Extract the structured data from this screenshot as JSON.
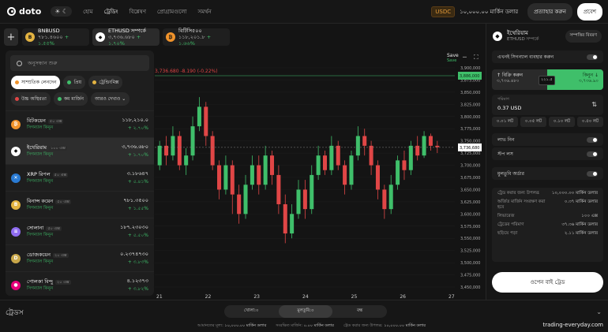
{
  "header": {
    "brand": "doto",
    "theme_toggle": "☀ ☾",
    "nav": [
      "হোম",
      "ট্রেডিং",
      "বিশ্লেষণ",
      "প্রোগ্রামগুলো",
      "সমর্থন"
    ],
    "active_nav": 1,
    "currency": "USDC",
    "balance": "১০,০০০.০০ মার্কিন ডলার",
    "deposit": "প্রত্যাহার করুন",
    "login": "প্রবেশ"
  },
  "tabs": [
    {
      "name": "BNBUSD",
      "price": "৭৮১.৪৬০০",
      "change": "+ ১.৫৫%",
      "color": "#e3b341",
      "glyph": "B"
    },
    {
      "name": "ETHUSD সম্পর্কে",
      "price": "৩,৭৩৬.৬৮০",
      "change": "+ ১.৭০%",
      "color": "#ffffff",
      "glyph": "◆",
      "active": true
    },
    {
      "name": "বিটিসি৫০০",
      "price": "১১৮,২০১.৮",
      "change": "+ ১.৬৬%",
      "color": "#f0932b",
      "glyph": "₿"
    }
  ],
  "panel": {
    "search_placeholder": "অনুসন্ধান শুরু",
    "chips": [
      {
        "label": "সাম্প্রতিক লেনদেন",
        "color": "#f0932b",
        "active": true
      },
      {
        "label": "প্রিয়",
        "color": "#3fbf6a"
      },
      {
        "label": "ট্রেন্ডিংমিক্স",
        "color": "#e3b341"
      },
      {
        "label": "উচ্চ অস্থিরতা",
        "color": "#e04646"
      },
      {
        "label": "কম মার্জিন",
        "color": "#3fbf6a"
      },
      {
        "label": "আরও দেখাও ⌄",
        "color": ""
      }
    ],
    "signal_label": "সিগন্যাল কিনুন",
    "items": [
      {
        "name": "বিটকয়েন",
        "tag": "৫০ এক্স",
        "price": "১১৮,২১০.০",
        "change": "+ ২.৭০%",
        "color": "#f0932b",
        "glyph": "₿"
      },
      {
        "name": "ইথেরিয়াম",
        "tag": "১০০ এক্স",
        "price": "৩,৭৩৬.৬৮০",
        "change": "+ ১.৭০%",
        "color": "#ffffff",
        "glyph": "◆",
        "sel": true
      },
      {
        "name": "XRP রিপল",
        "tag": "৫০ এক্স",
        "price": "৩.১৮৬৪৭",
        "change": "+ ৫.৪১%",
        "color": "#2a7bd4",
        "glyph": "✕"
      },
      {
        "name": "বিনান্স কয়েন",
        "tag": "৫০ এক্স",
        "price": "৭৮১.৩৫০০",
        "change": "+ ১.৫৫%",
        "color": "#e3b341",
        "glyph": "B"
      },
      {
        "name": "সোলানা",
        "tag": "৫০ এক্স",
        "price": "১৮৭.২৩০৩০",
        "change": "+ ৫.৫০%",
        "color": "#8f6cf0",
        "glyph": "≡"
      },
      {
        "name": "ডোজকয়েন",
        "tag": "২০ এক্স",
        "price": "০.২৩৭৪৭৩০",
        "change": "+ ৩.৮৩%",
        "color": "#c8a74a",
        "glyph": "D"
      },
      {
        "name": "পোলকা বিন্দু",
        "tag": "২০ এক্স",
        "price": "৪.১২৩৭৩",
        "change": "+ ৩.৮২%",
        "color": "#e6007a",
        "glyph": "●"
      }
    ]
  },
  "chart": {
    "save_label": "Save",
    "save_sub": "Save",
    "ohlc": "3,736.680 -8.190 (-0.22%)",
    "y_labels": [
      "3,900,000",
      "3,875,000",
      "3,850,000",
      "3,825,000",
      "3,800,000",
      "3,775,000",
      "3,750,000",
      "3,725,000",
      "3,700,000",
      "3,675,000",
      "3,650,000",
      "3,625,000",
      "3,600,000",
      "3,575,000",
      "3,550,000",
      "3,525,000",
      "3,500,000",
      "3,475,000",
      "3,450,000"
    ],
    "x_labels": [
      "21",
      "22",
      "23",
      "24",
      "25",
      "26",
      "27"
    ],
    "last_price": "3,736,680",
    "bid_price": "3,886,000"
  },
  "chart_data": {
    "type": "candlestick",
    "x": [
      "21",
      "22",
      "23",
      "24",
      "25",
      "26",
      "27"
    ],
    "ylim": [
      3450,
      3900
    ],
    "last": 3736.68,
    "candles": [
      [
        3700,
        3740,
        3690,
        3750
      ],
      [
        3740,
        3720,
        3700,
        3760
      ],
      [
        3720,
        3760,
        3710,
        3780
      ],
      [
        3760,
        3700,
        3690,
        3770
      ],
      [
        3700,
        3720,
        3680,
        3735
      ],
      [
        3720,
        3780,
        3710,
        3800
      ],
      [
        3780,
        3820,
        3770,
        3840
      ],
      [
        3820,
        3760,
        3740,
        3830
      ],
      [
        3760,
        3700,
        3690,
        3770
      ],
      [
        3700,
        3650,
        3630,
        3710
      ],
      [
        3650,
        3700,
        3640,
        3720
      ],
      [
        3700,
        3640,
        3600,
        3710
      ],
      [
        3640,
        3600,
        3580,
        3660
      ],
      [
        3600,
        3660,
        3590,
        3680
      ],
      [
        3660,
        3700,
        3650,
        3720
      ],
      [
        3700,
        3660,
        3640,
        3720
      ],
      [
        3660,
        3720,
        3650,
        3740
      ],
      [
        3720,
        3680,
        3660,
        3730
      ],
      [
        3680,
        3620,
        3600,
        3700
      ],
      [
        3620,
        3560,
        3540,
        3640
      ],
      [
        3560,
        3600,
        3550,
        3620
      ],
      [
        3600,
        3650,
        3590,
        3670
      ],
      [
        3650,
        3610,
        3590,
        3670
      ],
      [
        3610,
        3680,
        3600,
        3700
      ],
      [
        3680,
        3720,
        3670,
        3740
      ],
      [
        3720,
        3690,
        3680,
        3730
      ],
      [
        3690,
        3740,
        3680,
        3760
      ],
      [
        3740,
        3700,
        3690,
        3750
      ],
      [
        3700,
        3660,
        3640,
        3710
      ],
      [
        3660,
        3720,
        3650,
        3730
      ],
      [
        3720,
        3760,
        3710,
        3780
      ],
      [
        3760,
        3740,
        3720,
        3775
      ],
      [
        3740,
        3700,
        3680,
        3750
      ],
      [
        3700,
        3650,
        3630,
        3710
      ],
      [
        3650,
        3610,
        3590,
        3660
      ],
      [
        3610,
        3660,
        3600,
        3680
      ],
      [
        3660,
        3710,
        3650,
        3720
      ],
      [
        3710,
        3690,
        3670,
        3730
      ],
      [
        3690,
        3740,
        3680,
        3750
      ],
      [
        3740,
        3720,
        3710,
        3760
      ],
      [
        3720,
        3760,
        3715,
        3770
      ],
      [
        3760,
        3740,
        3730,
        3765
      ],
      [
        3740,
        3737,
        3725,
        3750
      ]
    ]
  },
  "right": {
    "title": "ইথেরিয়াম",
    "subtitle": "ETHUSD সম্পর্কে",
    "details": "সম্পত্তির বিবরণ",
    "signals": "এখনই সিগন্যাল ব্যবহার করুন",
    "sell_label": "↑ বিক্রি করুন",
    "sell_value": "৩,৭৩৬.৬৮০",
    "spread": "২২১.৫",
    "buy_label": "কিনুন ↓",
    "buy_value": "৩,৭৩৬.৯০",
    "amount_label": "পরিমাণ",
    "amount_value": "0.37 USD",
    "swap": "⇅",
    "lots": [
      "০.০১ লট",
      "০.০৫ লট",
      "০.১০ লট",
      "০.৫০ লট"
    ],
    "take_profit": "লাভ নিন",
    "stop_loss": "স্টপ লস",
    "pending": "মুলতুবি অর্ডার",
    "info": [
      {
        "k": "ট্রেড করার জন্য উপলব্ধ",
        "v": "১০,০০০.০০ মার্কিন ডলার"
      },
      {
        "k": "অর্জিত মার্জিন সংরক্ষণ করা হবে",
        "v": "০.৩৭ মার্কিন ডলার"
      },
      {
        "k": "লিভারেজ",
        "v": "১০০ এক্স"
      },
      {
        "k": "ট্রেডের পরিমাণ",
        "v": "৩৭.৩৬ মার্কিন ডলার"
      },
      {
        "k": "ছড়িয়ে পড়া",
        "v": "২.১১ মার্কিন ডলার"
      }
    ],
    "open": "ওপেন বাই ট্রেড"
  },
  "bottom": {
    "trades": "ট্রেডস",
    "tabs": [
      "খোলা:০",
      "মুলতুবি:০",
      "বন্ধ"
    ],
    "footer": [
      {
        "k": "আমানতের মূল্য:",
        "v": "১০,০০০.০০ মার্কিন ডলার"
      },
      {
        "k": "সংরক্ষিত মার্জিন:",
        "v": "০.০০ মার্কিন ডলার"
      },
      {
        "k": "ট্রেড করার জন্য উপলব্ধ:",
        "v": "১০,০০০.০০ মার্কিন ডলার"
      }
    ]
  },
  "watermark": "trading-everyday.com",
  "colors": {
    "up": "#3fbf6a",
    "down": "#e04646",
    "accent": "#3fbf6a"
  }
}
